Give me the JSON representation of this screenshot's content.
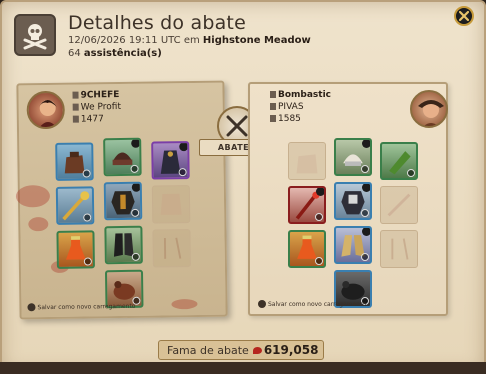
{
  "header": {
    "title": "Detalhes do abate",
    "datetime": "12/06/2026 19:11 UTC em",
    "location": "Highstone Meadow",
    "assists_count": "64",
    "assists_label": "assistência(s)"
  },
  "killer": {
    "name": "9CHEFE",
    "guild": "We Profit",
    "item_power": "1477",
    "save_loadout": "Salvar como novo carregamento"
  },
  "victim": {
    "name": "Bombastic",
    "guild": "PIVAS",
    "item_power": "1585",
    "save_loadout": "Salvar como novo carregamento"
  },
  "verdict": "ABATEU",
  "fame": {
    "label": "Fama de abate",
    "value": "619,058"
  },
  "colors": {
    "panel": "#efe3cc",
    "blood": "#a5281e",
    "accent_gold": "#c69a3a",
    "text_dark": "#2a1f17"
  },
  "icons": [
    "skull-crossbones-icon",
    "close-icon",
    "crossed-swords-icon",
    "blood-drop-icon"
  ]
}
